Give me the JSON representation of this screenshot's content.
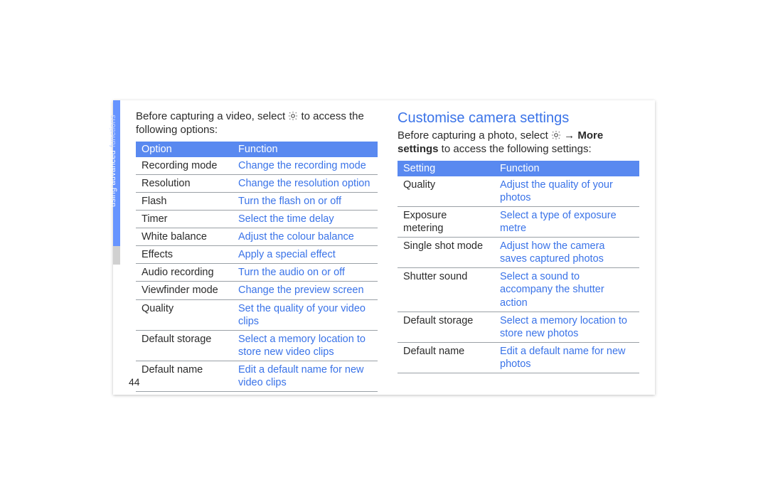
{
  "side_label": {
    "bright": "using advanced",
    "dim": "functions"
  },
  "page_number": "44",
  "left": {
    "intro_before": "Before capturing a video, select ",
    "intro_after": " to access the following options:",
    "table": {
      "headers": {
        "option": "Option",
        "function": "Function"
      },
      "rows": [
        {
          "option": "Recording mode",
          "function": "Change the recording mode"
        },
        {
          "option": "Resolution",
          "function": "Change the resolution option"
        },
        {
          "option": "Flash",
          "function": "Turn the flash on or off"
        },
        {
          "option": "Timer",
          "function": "Select the time delay"
        },
        {
          "option": "White balance",
          "function": "Adjust the colour balance"
        },
        {
          "option": "Effects",
          "function": "Apply a special effect"
        },
        {
          "option": "Audio recording",
          "function": "Turn the audio on or off"
        },
        {
          "option": "Viewfinder mode",
          "function": "Change the preview screen"
        },
        {
          "option": "Quality",
          "function": "Set the quality of your video clips"
        },
        {
          "option": "Default storage",
          "function": "Select a memory location to store new video clips"
        },
        {
          "option": "Default name",
          "function": "Edit a default name for new video clips"
        }
      ]
    }
  },
  "right": {
    "heading": "Customise camera settings",
    "intro_before": "Before capturing a photo, select ",
    "intro_mid1": " → ",
    "intro_bold": "More settings",
    "intro_after": " to access the following settings:",
    "table": {
      "headers": {
        "option": "Setting",
        "function": "Function"
      },
      "rows": [
        {
          "option": "Quality",
          "function": "Adjust the quality of your photos"
        },
        {
          "option": "Exposure metering",
          "function": "Select a type of exposure metre"
        },
        {
          "option": "Single shot mode",
          "function": "Adjust how the camera saves captured photos"
        },
        {
          "option": "Shutter sound",
          "function": "Select a sound to accompany the shutter action"
        },
        {
          "option": "Default storage",
          "function": "Select a memory location to store new photos"
        },
        {
          "option": "Default name",
          "function": "Edit a default name for new photos"
        }
      ]
    }
  }
}
